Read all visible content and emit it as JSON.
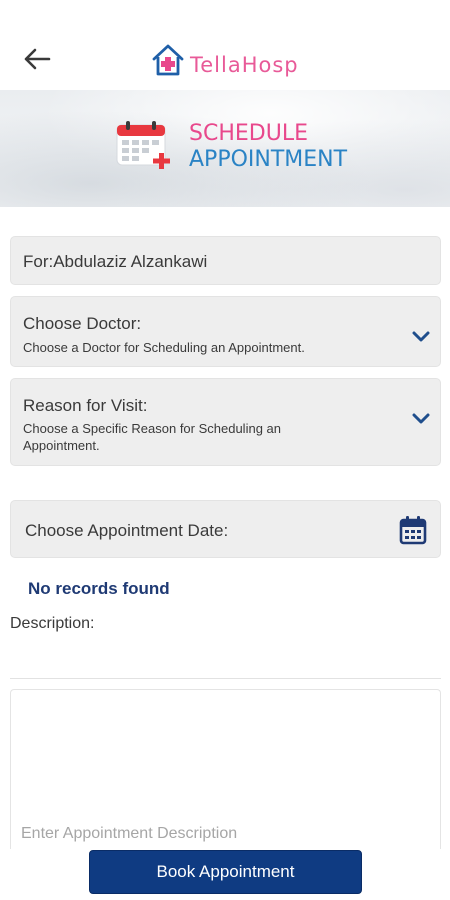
{
  "header": {
    "back_icon": "arrow-left-icon",
    "logo_text": "TellaHosp",
    "logo_icon": "hospital-house-icon"
  },
  "banner": {
    "icon": "calendar-plus-icon",
    "title_line1": "SCHEDULE",
    "title_line2": "APPOINTMENT",
    "colors": {
      "title_line1": "#e8488c",
      "title_line2": "#2a83c5"
    }
  },
  "form": {
    "patient_field": "For:Abdulaziz Alzankawi",
    "doctor_dropdown": {
      "label": "Choose Doctor:",
      "hint": "Choose a Doctor for Scheduling an Appointment.",
      "icon": "chevron-down-icon"
    },
    "reason_dropdown": {
      "label": "Reason for Visit:",
      "hint": "Choose a Specific Reason for Scheduling an Appointment.",
      "icon": "chevron-down-icon"
    },
    "date_field": {
      "label": "Choose Appointment Date:",
      "icon": "calendar-icon"
    },
    "no_records": "No records found",
    "description_label": "Description:",
    "description_placeholder": "Enter Appointment Description"
  },
  "actions": {
    "book_button": "Book Appointment"
  },
  "colors": {
    "primary": "#0f3b82",
    "accent_pink": "#e8488c",
    "accent_blue": "#2a83c5",
    "field_bg": "#eeeeee"
  }
}
